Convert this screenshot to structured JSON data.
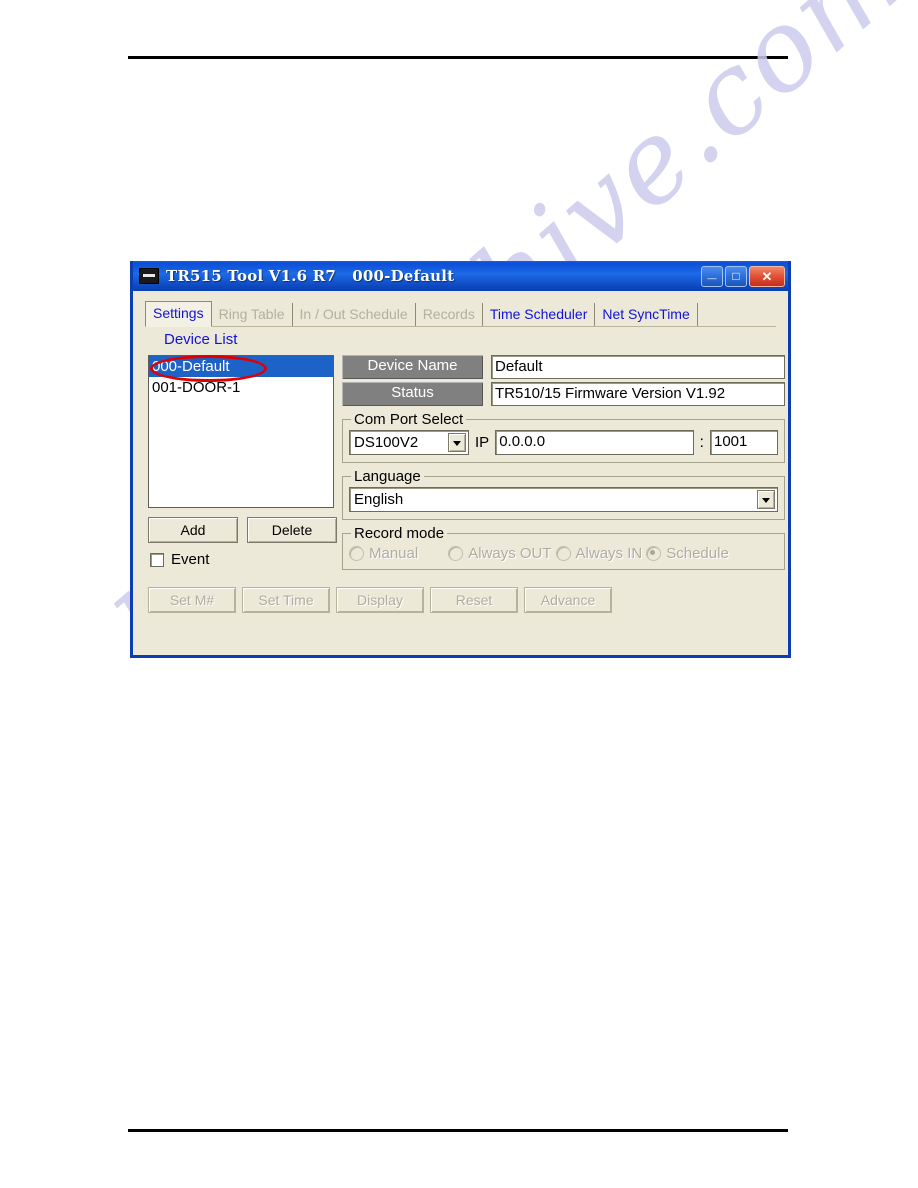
{
  "page": {
    "watermark": "manualshive.com"
  },
  "window": {
    "title": "TR515 Tool V1.6 R7   000-Default",
    "icon": "device-icon",
    "buttons": {
      "minimize": "_",
      "maximize": "□",
      "close": "✕"
    }
  },
  "tabs": [
    {
      "label": "Settings",
      "state": "active"
    },
    {
      "label": "Ring Table",
      "state": "disabled"
    },
    {
      "label": "In / Out Schedule",
      "state": "disabled"
    },
    {
      "label": "Records",
      "state": "disabled"
    },
    {
      "label": "Time Scheduler",
      "state": "enabled"
    },
    {
      "label": "Net SyncTime",
      "state": "enabled"
    }
  ],
  "settings": {
    "device_list_label": "Device List",
    "devices": [
      {
        "label": "000-Default",
        "selected": true
      },
      {
        "label": "001-DOOR-1",
        "selected": false
      }
    ],
    "add_label": "Add",
    "delete_label": "Delete",
    "event_label": "Event",
    "event_checked": false,
    "action_buttons": [
      {
        "label": "Set M#",
        "disabled": true
      },
      {
        "label": "Set Time",
        "disabled": true
      },
      {
        "label": "Display",
        "disabled": true
      },
      {
        "label": "Reset",
        "disabled": true
      },
      {
        "label": "Advance",
        "disabled": true
      }
    ],
    "device_name_label": "Device Name",
    "device_name_value": "Default",
    "status_label": "Status",
    "status_value": "TR510/15 Firmware Version V1.92",
    "com_port": {
      "group_label": "Com Port Select",
      "selected": "DS100V2",
      "ip_label": "IP",
      "ip_value": "0.0.0.0",
      "separator": ":",
      "port_value": "1001"
    },
    "language": {
      "group_label": "Language",
      "selected": "English"
    },
    "record_mode": {
      "group_label": "Record mode",
      "options": [
        {
          "label": "Manual",
          "checked": false
        },
        {
          "label": "Always OUT",
          "checked": false
        },
        {
          "label": "Always IN",
          "checked": false
        },
        {
          "label": "Schedule",
          "checked": true
        }
      ]
    }
  },
  "annotation": {
    "type": "red-ellipse",
    "target": "000-Default"
  },
  "colors": {
    "title_bar": "#0b4fd6",
    "window_border": "#0a3fb4",
    "tab_text": "#1212d8",
    "tab_disabled_text": "#b3b0a0",
    "selection": "#1d62c7",
    "face": "#ece9d8",
    "gray_button": "#808080",
    "annotation": "#e00000",
    "watermark": "#ccccee"
  }
}
